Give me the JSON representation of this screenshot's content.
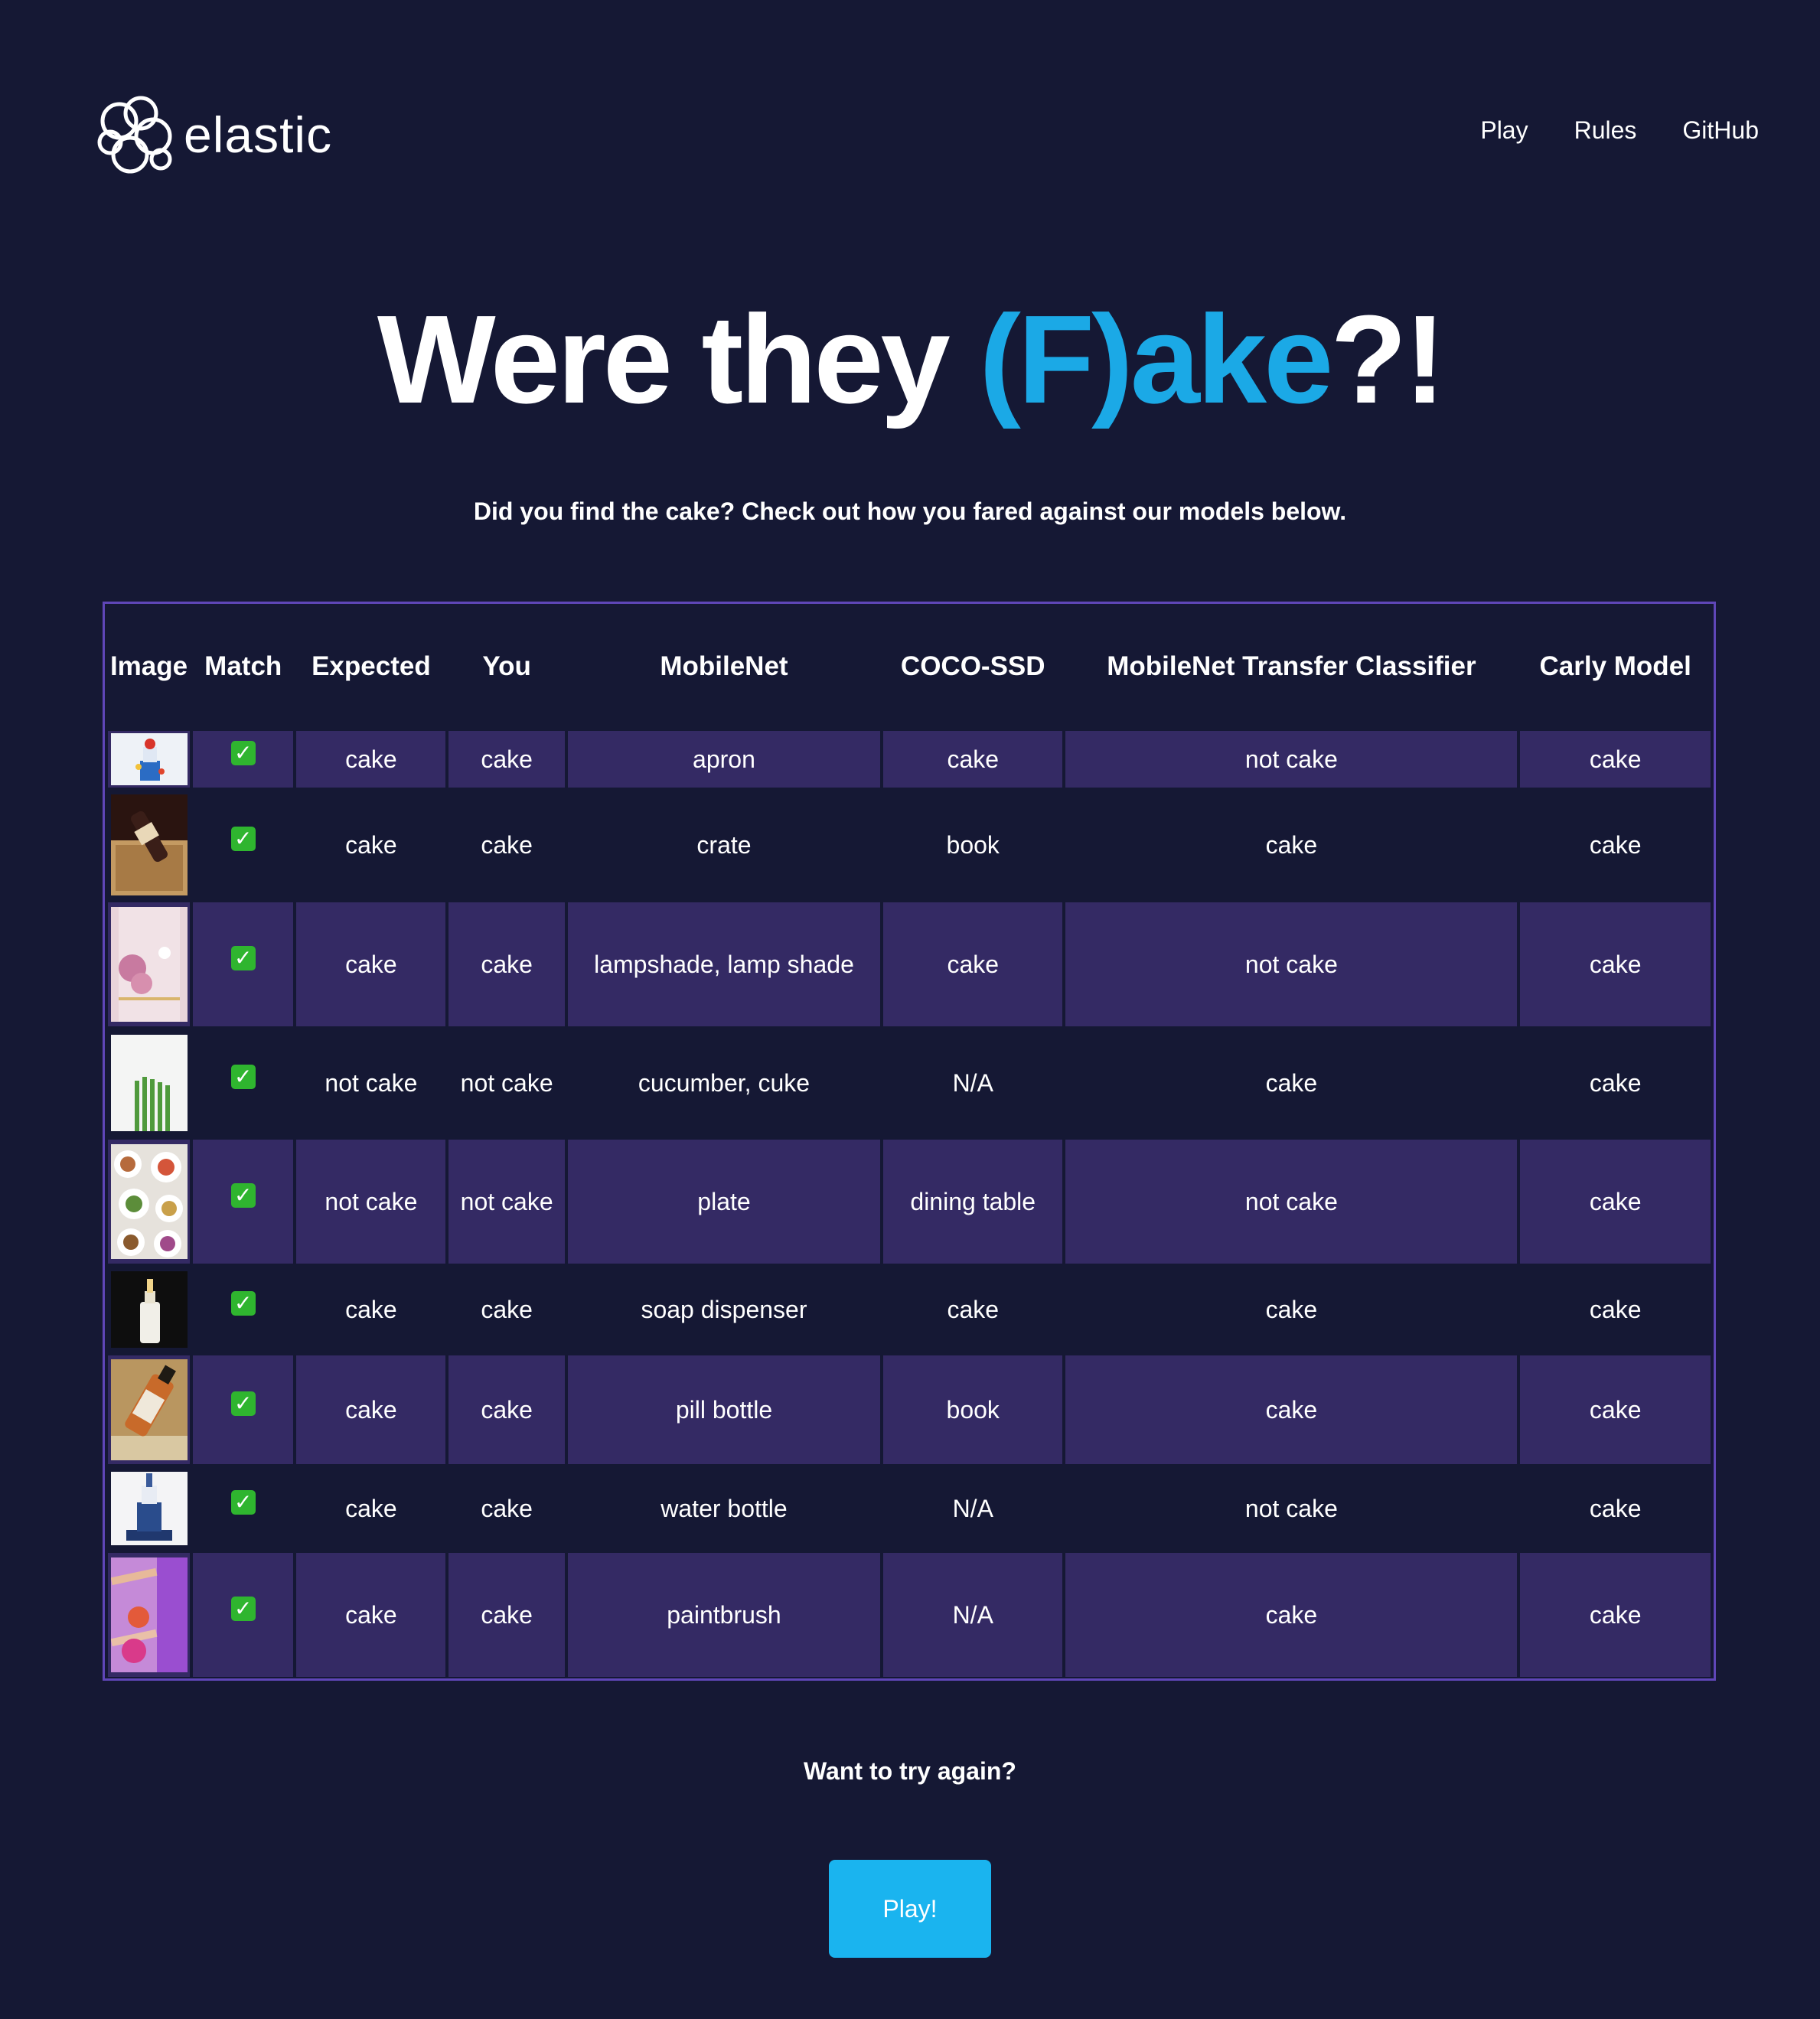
{
  "header": {
    "logo_text": "elastic",
    "nav": [
      "Play",
      "Rules",
      "GitHub"
    ]
  },
  "hero": {
    "title_part1": "Were they ",
    "title_accent": "(F)ake",
    "title_part2": "?!",
    "subtitle": "Did you find the cake? Check out how you fared against our models below."
  },
  "table": {
    "headers": [
      "Image",
      "Match",
      "Expected",
      "You",
      "MobileNet",
      "COCO-SSD",
      "MobileNet Transfer Classifier",
      "Carly Model"
    ],
    "rows": [
      {
        "match": "✓",
        "expected": "cake",
        "you": "cake",
        "mobilenet": "apron",
        "coco": "cake",
        "transfer": "not cake",
        "carly": "cake"
      },
      {
        "match": "✓",
        "expected": "cake",
        "you": "cake",
        "mobilenet": "crate",
        "coco": "book",
        "transfer": "cake",
        "carly": "cake"
      },
      {
        "match": "✓",
        "expected": "cake",
        "you": "cake",
        "mobilenet": "lampshade, lamp shade",
        "coco": "cake",
        "transfer": "not cake",
        "carly": "cake"
      },
      {
        "match": "✓",
        "expected": "not cake",
        "you": "not cake",
        "mobilenet": "cucumber, cuke",
        "coco": "N/A",
        "transfer": "cake",
        "carly": "cake"
      },
      {
        "match": "✓",
        "expected": "not cake",
        "you": "not cake",
        "mobilenet": "plate",
        "coco": "dining table",
        "transfer": "not cake",
        "carly": "cake"
      },
      {
        "match": "✓",
        "expected": "cake",
        "you": "cake",
        "mobilenet": "soap dispenser",
        "coco": "cake",
        "transfer": "cake",
        "carly": "cake"
      },
      {
        "match": "✓",
        "expected": "cake",
        "you": "cake",
        "mobilenet": "pill bottle",
        "coco": "book",
        "transfer": "cake",
        "carly": "cake"
      },
      {
        "match": "✓",
        "expected": "cake",
        "you": "cake",
        "mobilenet": "water bottle",
        "coco": "N/A",
        "transfer": "not cake",
        "carly": "cake"
      },
      {
        "match": "✓",
        "expected": "cake",
        "you": "cake",
        "mobilenet": "paintbrush",
        "coco": "N/A",
        "transfer": "cake",
        "carly": "cake"
      }
    ]
  },
  "footer": {
    "try_again": "Want to try again?",
    "play_button": "Play!"
  },
  "colors": {
    "background": "#151834",
    "accent": "#1ba9e6",
    "row_highlight": "#342a64",
    "table_border": "#5f46b8",
    "button": "#1ab4ef",
    "check": "#2fb52f"
  }
}
